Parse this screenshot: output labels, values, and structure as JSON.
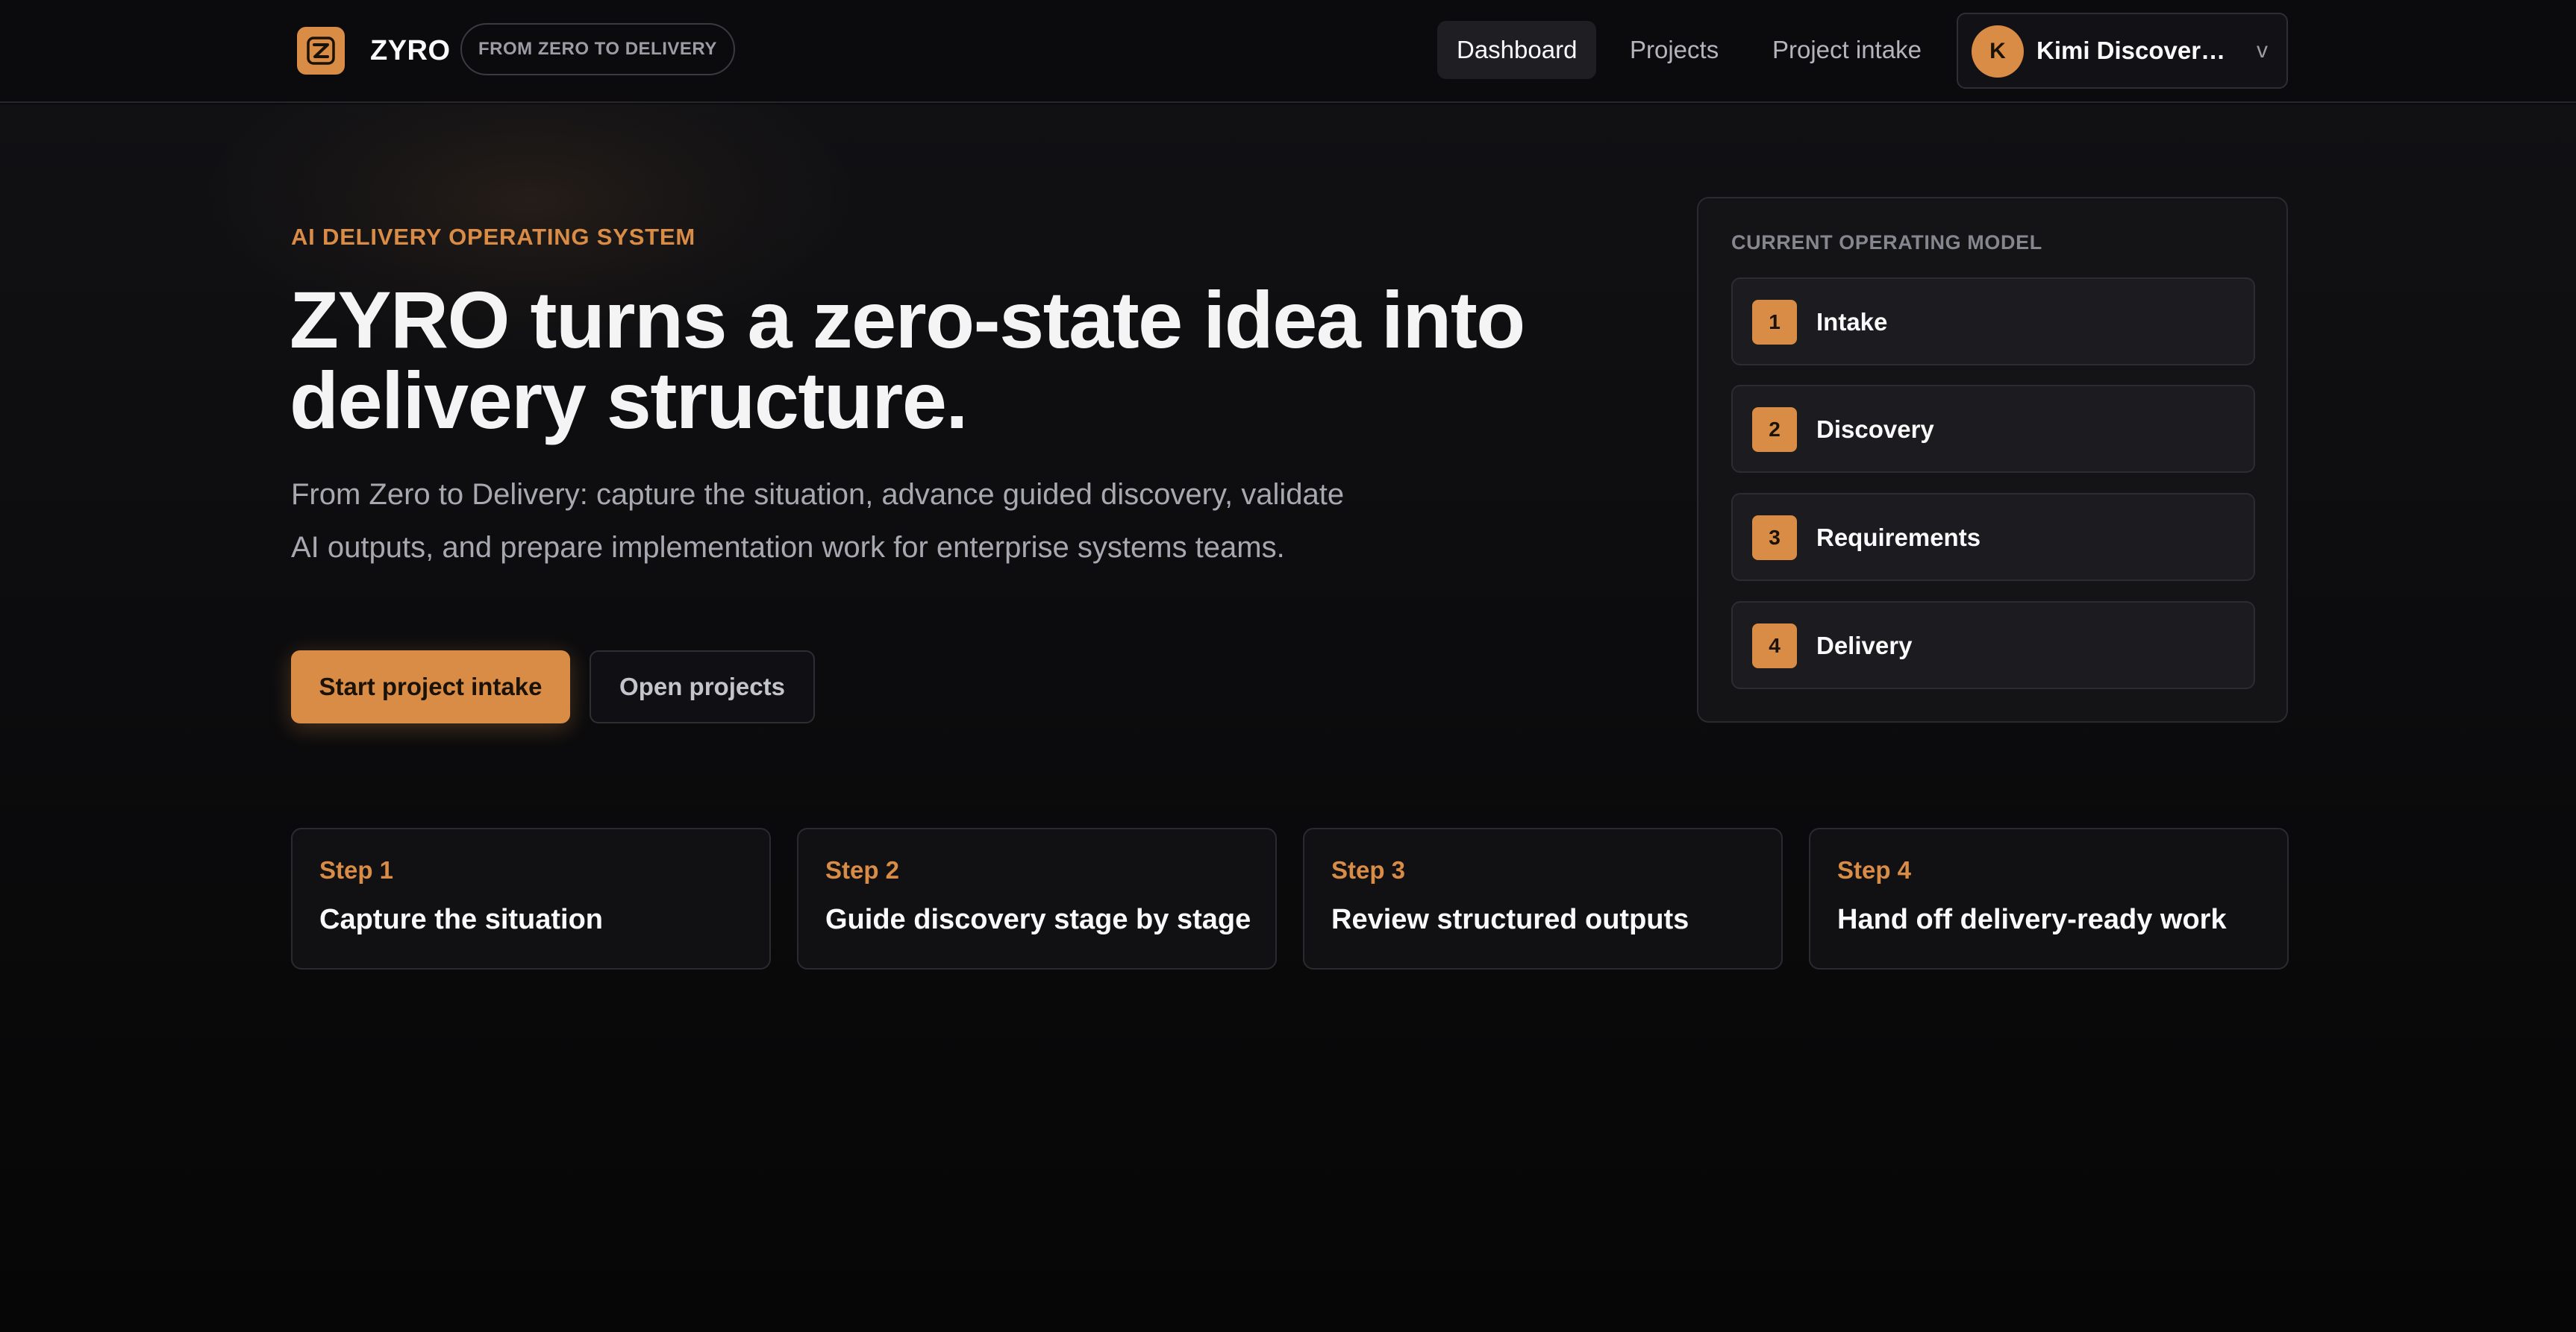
{
  "brand": {
    "name": "ZYRO",
    "tagline": "FROM ZERO TO DELIVERY",
    "logo_icon": "z-logo-icon",
    "accent_color": "#d98c45"
  },
  "nav": {
    "items": [
      {
        "label": "Dashboard",
        "active": true
      },
      {
        "label": "Projects",
        "active": false
      },
      {
        "label": "Project intake",
        "active": false
      }
    ],
    "user": {
      "initial": "K",
      "name": "Kimi Discovery A...",
      "chevron": "v"
    }
  },
  "hero": {
    "eyebrow": "AI DELIVERY OPERATING SYSTEM",
    "title": "ZYRO turns a zero-state idea into delivery structure.",
    "subtitle": "From Zero to Delivery: capture the situation, advance guided discovery, validate AI outputs, and prepare implementation work for enterprise systems teams.",
    "primary_cta": "Start project intake",
    "secondary_cta": "Open projects"
  },
  "operating_model": {
    "label": "CURRENT OPERATING MODEL",
    "steps": [
      {
        "number": "1",
        "name": "Intake"
      },
      {
        "number": "2",
        "name": "Discovery"
      },
      {
        "number": "3",
        "name": "Requirements"
      },
      {
        "number": "4",
        "name": "Delivery"
      }
    ]
  },
  "flow": [
    {
      "kicker": "Step 1",
      "title": "Capture the situation"
    },
    {
      "kicker": "Step 2",
      "title": "Guide discovery stage by stage"
    },
    {
      "kicker": "Step 3",
      "title": "Review structured outputs"
    },
    {
      "kicker": "Step 4",
      "title": "Hand off delivery-ready work"
    }
  ]
}
